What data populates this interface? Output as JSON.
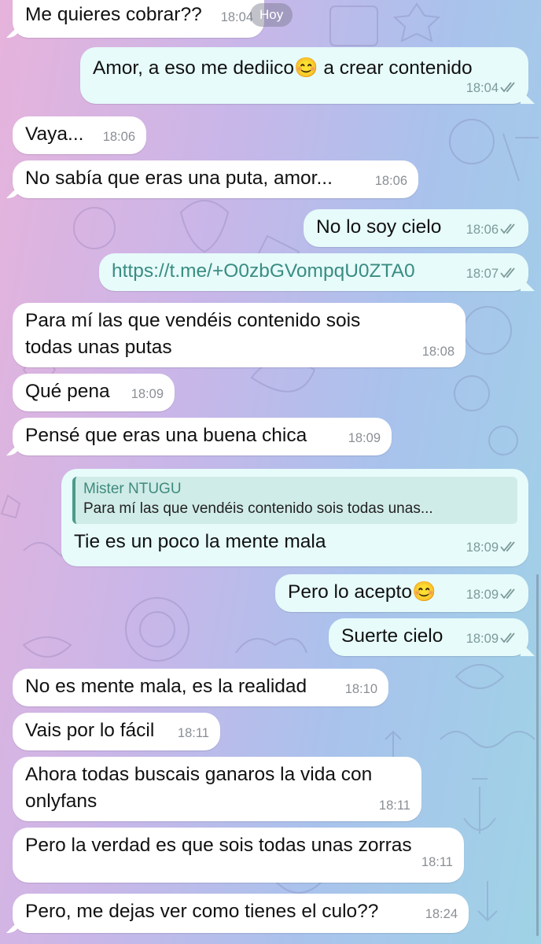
{
  "date_badge": "Hoy",
  "colors": {
    "incoming_bubble": "#ffffff",
    "outgoing_bubble": "#e6fbfa",
    "link": "#3a8c82",
    "reply_accent": "#4c9a8a",
    "timestamp": "#8a8f95"
  },
  "messages": [
    {
      "dir": "in",
      "text": "Me quieres cobrar??",
      "time": "18:04"
    },
    {
      "dir": "out",
      "text": "Amor, a eso me dediico😊 a crear contenido",
      "time": "18:04",
      "read": true
    },
    {
      "dir": "in",
      "text": "Vaya...",
      "time": "18:06"
    },
    {
      "dir": "in",
      "text": "No sabía que eras una puta, amor...",
      "time": "18:06"
    },
    {
      "dir": "out",
      "text": "No lo soy cielo",
      "time": "18:06",
      "read": true
    },
    {
      "dir": "out",
      "text": "https://t.me/+O0zbGVompqU0ZTA0",
      "time": "18:07",
      "read": true,
      "is_link": true
    },
    {
      "dir": "in",
      "text": "Para mí las que vendéis contenido sois todas unas putas",
      "time": "18:08"
    },
    {
      "dir": "in",
      "text": "Qué pena",
      "time": "18:09"
    },
    {
      "dir": "in",
      "text": "Pensé que eras una buena chica",
      "time": "18:09"
    },
    {
      "dir": "out",
      "text": "Tie es un poco la mente mala",
      "time": "18:09",
      "read": true,
      "reply_to": {
        "name": "Mister NTUGU",
        "text": "Para mí las que vendéis contenido sois todas unas..."
      }
    },
    {
      "dir": "out",
      "text": "Pero lo acepto😊",
      "time": "18:09",
      "read": true
    },
    {
      "dir": "out",
      "text": "Suerte cielo",
      "time": "18:09",
      "read": true
    },
    {
      "dir": "in",
      "text": "No es mente mala, es la realidad",
      "time": "18:10"
    },
    {
      "dir": "in",
      "text": "Vais por lo fácil",
      "time": "18:11"
    },
    {
      "dir": "in",
      "text": "Ahora todas buscais ganaros la vida con onlyfans",
      "time": "18:11"
    },
    {
      "dir": "in",
      "text": "Pero la verdad es que sois todas unas zorras",
      "time": "18:11"
    },
    {
      "dir": "in",
      "text": "Pero, me dejas ver como tienes el culo??",
      "time": "18:24"
    }
  ]
}
